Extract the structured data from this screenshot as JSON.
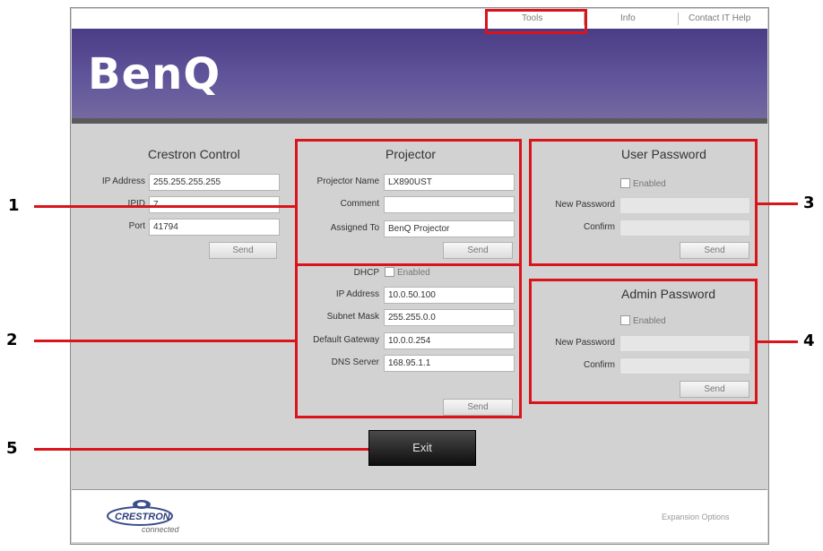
{
  "nav": {
    "tools": "Tools",
    "info": "Info",
    "contact": "Contact IT Help"
  },
  "brand": {
    "logo": "BenQ"
  },
  "crestron": {
    "title": "Crestron Control",
    "ip_label": "IP Address",
    "ip_value": "255.255.255.255",
    "ipid_label": "IPID",
    "ipid_value": "7",
    "port_label": "Port",
    "port_value": "41794",
    "send": "Send"
  },
  "projector": {
    "title": "Projector",
    "name_label": "Projector Name",
    "name_value": "LX890UST",
    "comment_label": "Comment",
    "comment_value": "",
    "assigned_label": "Assigned To",
    "assigned_value": "BenQ Projector",
    "send": "Send"
  },
  "network": {
    "dhcp_label": "DHCP",
    "dhcp_enabled": "Enabled",
    "ip_label": "IP Address",
    "ip_value": "10.0.50.100",
    "mask_label": "Subnet Mask",
    "mask_value": "255.255.0.0",
    "gateway_label": "Default Gateway",
    "gateway_value": "10.0.0.254",
    "dns_label": "DNS Server",
    "dns_value": "168.95.1.1",
    "send": "Send"
  },
  "user_password": {
    "title": "User Password",
    "enabled": "Enabled",
    "new_label": "New Password",
    "confirm_label": "Confirm",
    "send": "Send"
  },
  "admin_password": {
    "title": "Admin Password",
    "enabled": "Enabled",
    "new_label": "New Password",
    "confirm_label": "Confirm",
    "send": "Send"
  },
  "exit": "Exit",
  "footer": {
    "crestron_logo": "CRESTRON",
    "crestron_sub": "connected",
    "expansion": "Expansion Options"
  },
  "callouts": {
    "c1": "1",
    "c2": "2",
    "c3": "3",
    "c4": "4",
    "c5": "5"
  },
  "colors": {
    "highlight": "#d9141b",
    "banner": "#4b3c86"
  }
}
